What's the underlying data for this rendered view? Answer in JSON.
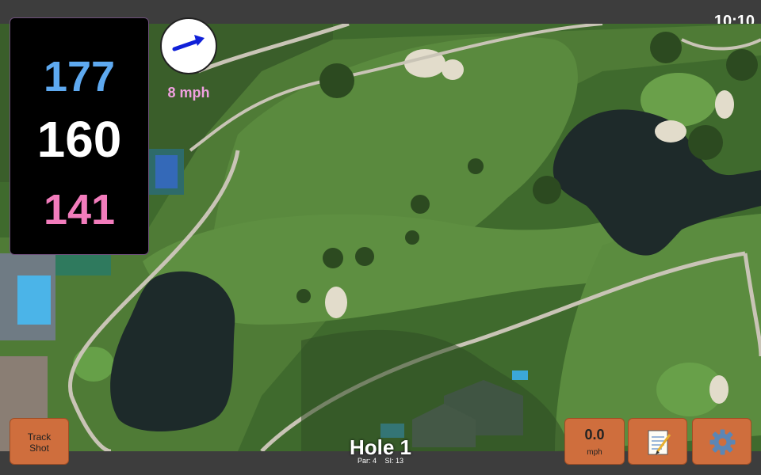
{
  "status": {
    "time": "10:10"
  },
  "distances": {
    "back": "177",
    "middle": "160",
    "front": "141"
  },
  "wind": {
    "speed": "8 mph",
    "direction_icon": "arrow-icon"
  },
  "buttons": {
    "track_shot": "Track\nShot",
    "speed_value": "0.0",
    "speed_unit": "mph",
    "notes_icon": "notepad-icon",
    "settings_icon": "gear-icon"
  },
  "hole": {
    "title": "Hole 1",
    "par": "Par: 4",
    "si": "SI: 13"
  },
  "colors": {
    "back": "#5ea9f0",
    "middle": "#ffffff",
    "front": "#f27cbc",
    "button": "#cf6e3d",
    "wind_text": "#f0a0e0"
  }
}
